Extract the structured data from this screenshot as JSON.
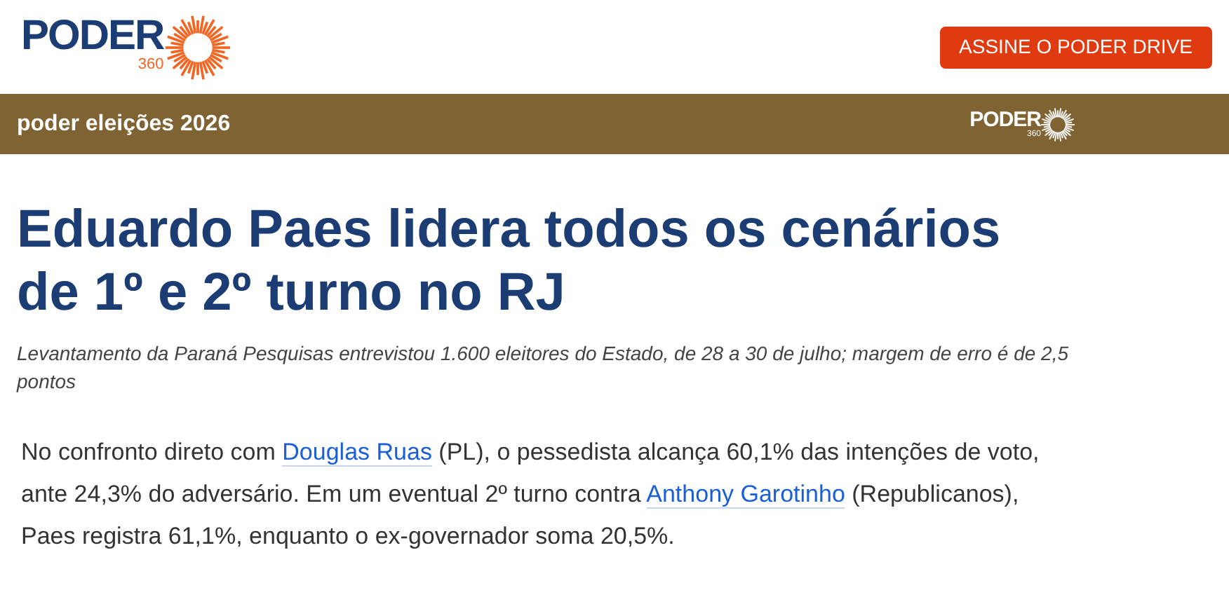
{
  "header": {
    "logo": {
      "name": "PODER",
      "sub": "360"
    },
    "button": "ASSINE O PODER DRIVE"
  },
  "section_bar": {
    "title": "poder eleições 2026",
    "logo": {
      "name": "PODER",
      "sub": "360"
    }
  },
  "article": {
    "headline": "Eduardo Paes lidera todos os cenários de 1º e 2º turno no RJ",
    "subtitle": "Levantamento da Paraná Pesquisas entrevistou 1.600 eleitores do Estado, de 28 a 30 de julho; margem de erro é de 2,5 pontos",
    "paragraph": [
      {
        "kind": "text",
        "text": "No confronto direto com "
      },
      {
        "kind": "link",
        "text": "Douglas Ruas"
      },
      {
        "kind": "text",
        "text": " (PL), o pessedista alcança 60,1% das intenções de voto, ante 24,3% do adversário. Em um eventual 2º turno contra "
      },
      {
        "kind": "link",
        "text": "Anthony Garotinho"
      },
      {
        "kind": "text",
        "text": " (Republicanos), Paes registra 61,1%, enquanto o ex-governador soma 20,5%."
      }
    ]
  }
}
